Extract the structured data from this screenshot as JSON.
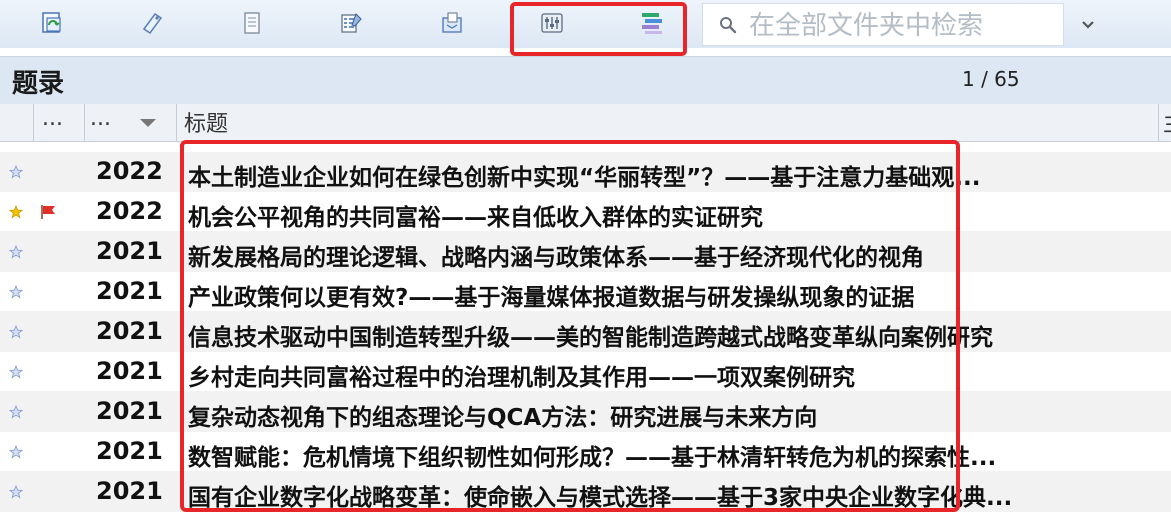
{
  "search": {
    "placeholder": "在全部文件夹中检索"
  },
  "header": {
    "title": "题录",
    "page_counter": "1 / 65"
  },
  "columns": {
    "col1": "...",
    "col2": "...",
    "col3": "标题",
    "col4": "主"
  },
  "rows": [
    {
      "year": "2022",
      "title": "本土制造业企业如何在绿色创新中实现“华丽转型”？——基于注意力基础观...",
      "starred": false,
      "flagged": false
    },
    {
      "year": "2022",
      "title": "机会公平视角的共同富裕——来自低收入群体的实证研究",
      "starred": true,
      "flagged": true
    },
    {
      "year": "2021",
      "title": "新发展格局的理论逻辑、战略内涵与政策体系——基于经济现代化的视角",
      "starred": false,
      "flagged": false
    },
    {
      "year": "2021",
      "title": "产业政策何以更有效?——基于海量媒体报道数据与研发操纵现象的证据",
      "starred": false,
      "flagged": false
    },
    {
      "year": "2021",
      "title": "信息技术驱动中国制造转型升级——美的智能制造跨越式战略变革纵向案例研究",
      "starred": false,
      "flagged": false
    },
    {
      "year": "2021",
      "title": "乡村走向共同富裕过程中的治理机制及其作用——一项双案例研究",
      "starred": false,
      "flagged": false
    },
    {
      "year": "2021",
      "title": "复杂动态视角下的组态理论与QCA方法：研究进展与未来方向",
      "starred": false,
      "flagged": false
    },
    {
      "year": "2021",
      "title": "数智赋能：危机情境下组织韧性如何形成？——基于林清轩转危为机的探索性...",
      "starred": false,
      "flagged": false
    },
    {
      "year": "2021",
      "title": "国有企业数字化战略变革：使命嵌入与模式选择——基于3家中央企业数字化典...",
      "starred": false,
      "flagged": false
    }
  ],
  "colors": {
    "accent": "#e8262a",
    "star_filled": "#f2c200",
    "star_empty": "#b9c9e8",
    "flag": "#e0302a"
  }
}
